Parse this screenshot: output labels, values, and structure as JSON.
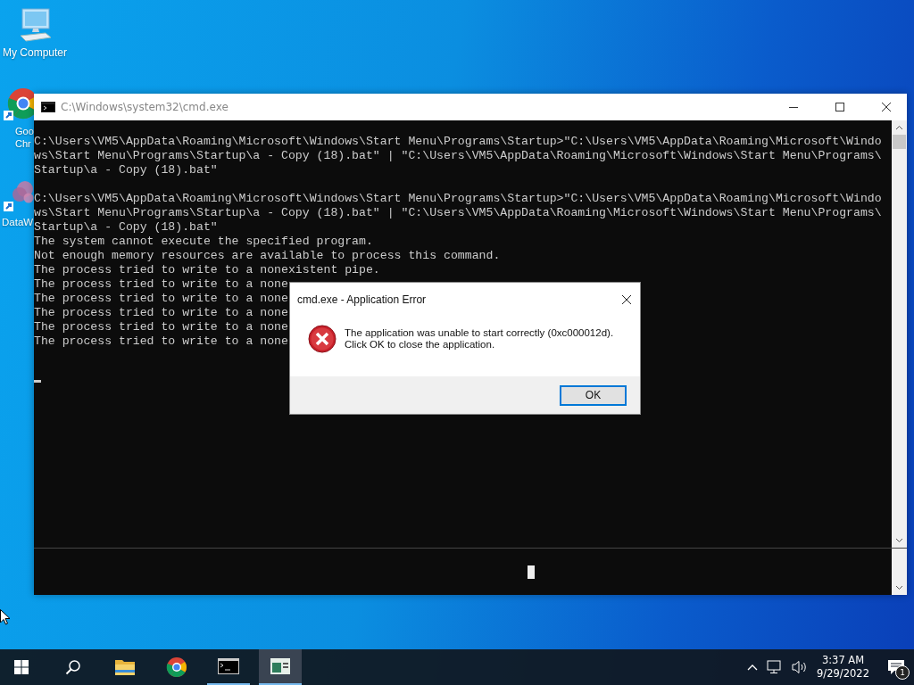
{
  "desktop_icons": [
    {
      "kind": "computer",
      "label_lines": [
        "My Computer"
      ]
    },
    {
      "kind": "chrome",
      "label_lines": [
        "Goo",
        "Chr"
      ]
    },
    {
      "kind": "app",
      "label_lines": [
        "DataW"
      ]
    }
  ],
  "console_window": {
    "title": "C:\\Windows\\system32\\cmd.exe",
    "paragraphs": [
      [
        "C:\\Users\\VM5\\AppData\\Roaming\\Microsoft\\Windows\\Start Menu\\Programs\\Startup>\"C:\\Users\\VM5\\AppData\\Roaming\\Microsoft\\Windo",
        "ws\\Start Menu\\Programs\\Startup\\a - Copy (18).bat\" | \"C:\\Users\\VM5\\AppData\\Roaming\\Microsoft\\Windows\\Start Menu\\Programs\\",
        "Startup\\a - Copy (18).bat\""
      ],
      [
        "C:\\Users\\VM5\\AppData\\Roaming\\Microsoft\\Windows\\Start Menu\\Programs\\Startup>\"C:\\Users\\VM5\\AppData\\Roaming\\Microsoft\\Windo",
        "ws\\Start Menu\\Programs\\Startup\\a - Copy (18).bat\" | \"C:\\Users\\VM5\\AppData\\Roaming\\Microsoft\\Windows\\Start Menu\\Programs\\",
        "Startup\\a - Copy (18).bat\"",
        "The system cannot execute the specified program.",
        "Not enough memory resources are available to process this command.",
        "The process tried to write to a nonexistent pipe.",
        "The process tried to write to a none",
        "The process tried to write to a none",
        "The process tried to write to a none",
        "The process tried to write to a none",
        "The process tried to write to a none"
      ]
    ]
  },
  "dialog": {
    "title": "cmd.exe - Application Error",
    "message_lines": [
      "The application was unable to start correctly (0xc000012d).",
      "Click OK to close the application."
    ],
    "buttons": [
      {
        "label": "OK",
        "selected": true
      }
    ]
  },
  "taskbar": {
    "items": [
      {
        "kind": "search",
        "running": false,
        "selected": false
      },
      {
        "kind": "folder",
        "running": false,
        "selected": false
      },
      {
        "kind": "chrome",
        "running": false,
        "selected": false
      },
      {
        "kind": "console",
        "running": true,
        "selected": false
      },
      {
        "kind": "window",
        "running": true,
        "selected": true
      }
    ]
  },
  "tray": {
    "time": "3:37 AM",
    "date": "9/29/2022",
    "notification_count": "1"
  }
}
